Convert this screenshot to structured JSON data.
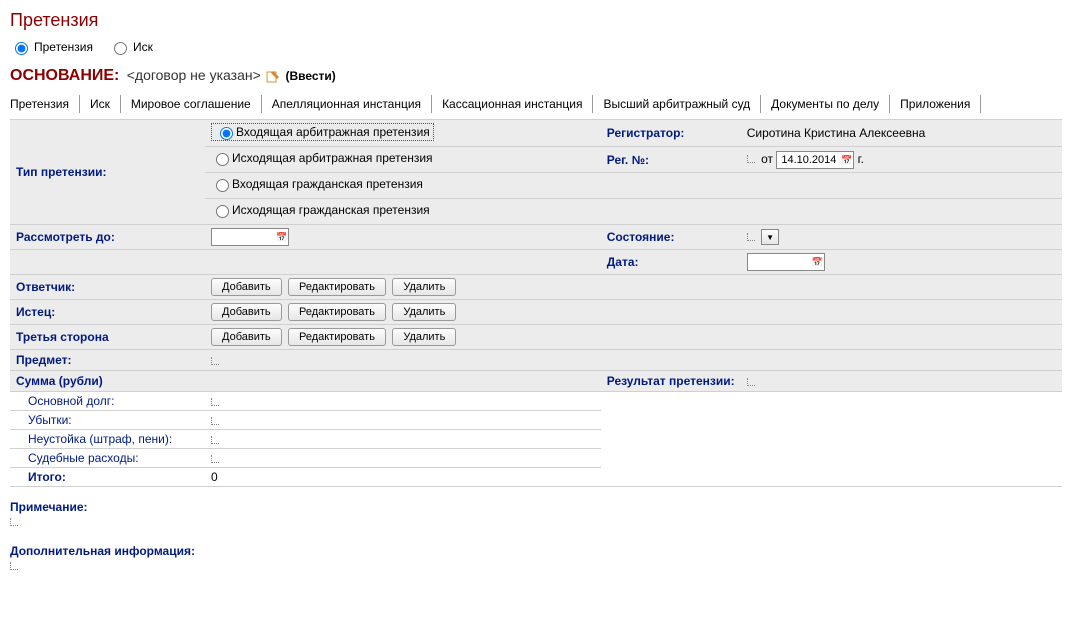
{
  "title": "Претензия",
  "type_selector": {
    "option1": "Претензия",
    "option2": "Иск"
  },
  "osnovanie": {
    "label": "ОСНОВАНИЕ:",
    "value": "<договор не указан>",
    "link": "(Ввести)"
  },
  "tabs": [
    "Претензия",
    "Иск",
    "Мировое соглашение",
    "Апелляционная инстанция",
    "Кассационная инстанция",
    "Высший арбитражный суд",
    "Документы по делу",
    "Приложения"
  ],
  "labels": {
    "claim_type": "Тип претензии:",
    "registrar": "Регистратор:",
    "reg_no": "Рег. №:",
    "ot": "от",
    "g": "г.",
    "consider_until": "Рассмотреть до:",
    "status": "Состояние:",
    "date": "Дата:",
    "respondent": "Ответчик:",
    "plaintiff": "Истец:",
    "third_party": "Третья сторона",
    "subject": "Предмет:",
    "sum": "Сумма (рубли)",
    "result": "Результат претензии:",
    "principal": "Основной долг:",
    "losses": "Убытки:",
    "penalty": "Неустойка (штраф, пени):",
    "court_costs": "Судебные расходы:",
    "total": "Итого:",
    "note": "Примечание:",
    "extra": "Дополнительная информация:"
  },
  "claim_types": {
    "opt1": "Входящая арбитражная претензия",
    "opt2": "Исходящая арбитражная претензия",
    "opt3": "Входящая гражданская претензия",
    "opt4": "Исходящая гражданская претензия"
  },
  "values": {
    "registrar": "Сиротина Кристина Алексеевна",
    "reg_date": "14.10.2014",
    "total": "0"
  },
  "buttons": {
    "add": "Добавить",
    "edit": "Редактировать",
    "delete": "Удалить"
  }
}
